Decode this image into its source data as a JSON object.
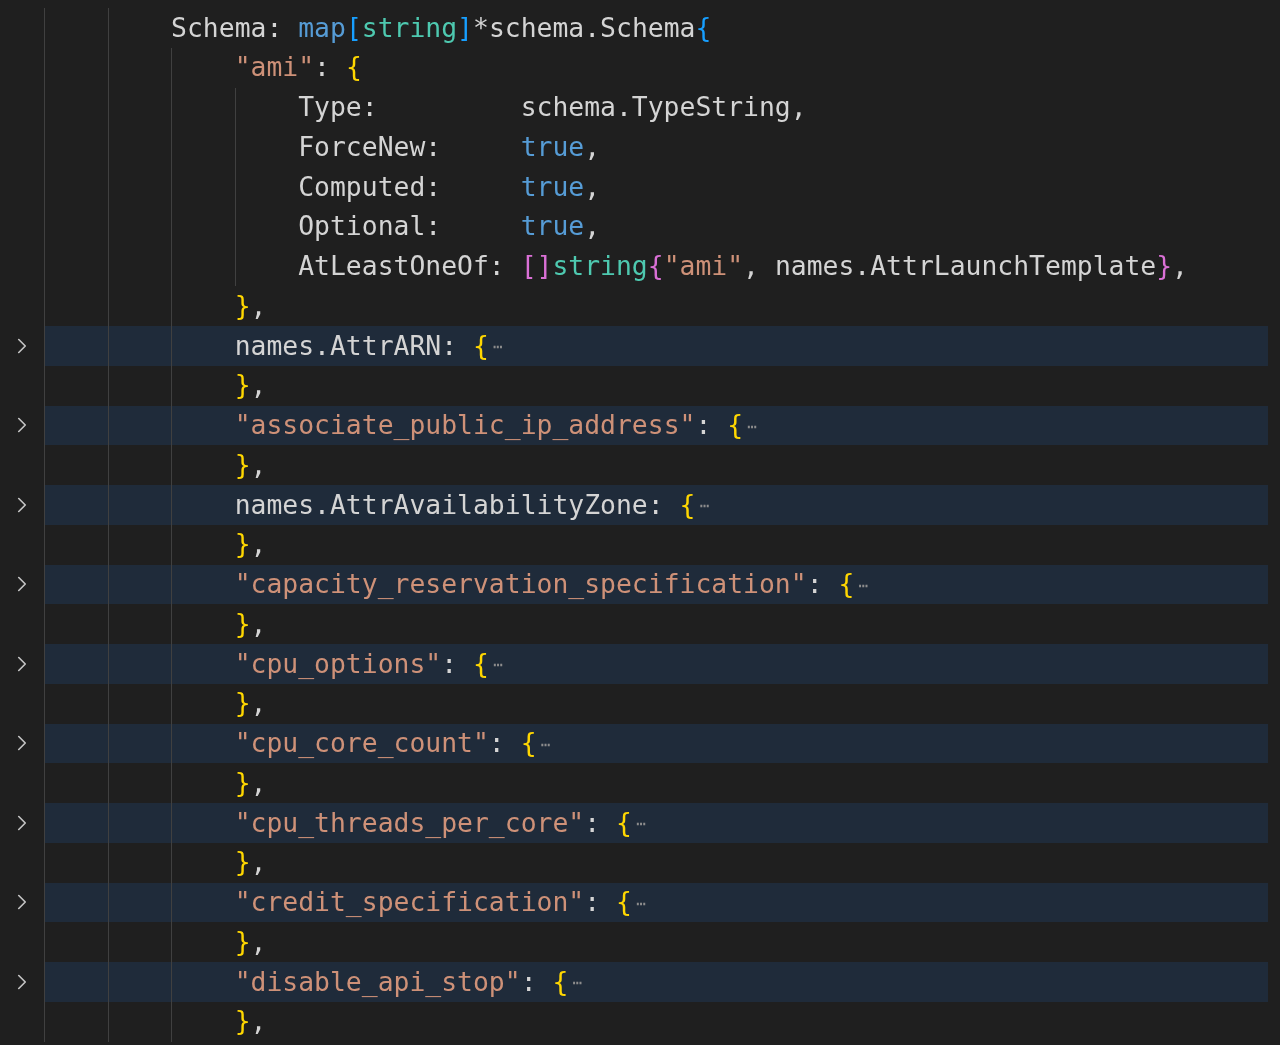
{
  "editor": {
    "lines": [
      {
        "folded": false,
        "tokens": [
          {
            "text": "Schema: ",
            "kind": "plain"
          },
          {
            "text": "map",
            "kind": "keyword"
          },
          {
            "text": "[",
            "kind": "bracket_blue"
          },
          {
            "text": "string",
            "kind": "type"
          },
          {
            "text": "]",
            "kind": "bracket_blue"
          },
          {
            "text": "*schema.Schema",
            "kind": "plain"
          },
          {
            "text": "{",
            "kind": "bracket_blue"
          }
        ],
        "children": [
          {
            "folded": false,
            "tokens": [
              {
                "text": "\"ami\"",
                "kind": "string"
              },
              {
                "text": ": ",
                "kind": "plain"
              },
              {
                "text": "{",
                "kind": "bracket_yellow"
              }
            ],
            "children": [
              {
                "folded": false,
                "tokens": [
                  {
                    "text": "Type:         schema.TypeString,",
                    "kind": "plain"
                  }
                ]
              },
              {
                "folded": false,
                "tokens": [
                  {
                    "text": "ForceNew:     ",
                    "kind": "plain"
                  },
                  {
                    "text": "true",
                    "kind": "keyword"
                  },
                  {
                    "text": ",",
                    "kind": "plain"
                  }
                ]
              },
              {
                "folded": false,
                "tokens": [
                  {
                    "text": "Computed:     ",
                    "kind": "plain"
                  },
                  {
                    "text": "true",
                    "kind": "keyword"
                  },
                  {
                    "text": ",",
                    "kind": "plain"
                  }
                ]
              },
              {
                "folded": false,
                "tokens": [
                  {
                    "text": "Optional:     ",
                    "kind": "plain"
                  },
                  {
                    "text": "true",
                    "kind": "keyword"
                  },
                  {
                    "text": ",",
                    "kind": "plain"
                  }
                ]
              },
              {
                "folded": false,
                "tokens": [
                  {
                    "text": "AtLeastOneOf: ",
                    "kind": "plain"
                  },
                  {
                    "text": "[]",
                    "kind": "bracket_pink"
                  },
                  {
                    "text": "string",
                    "kind": "type"
                  },
                  {
                    "text": "{",
                    "kind": "bracket_pink"
                  },
                  {
                    "text": "\"ami\"",
                    "kind": "string"
                  },
                  {
                    "text": ", names.AttrLaunchTemplate",
                    "kind": "plain"
                  },
                  {
                    "text": "}",
                    "kind": "bracket_pink"
                  },
                  {
                    "text": ",",
                    "kind": "plain"
                  }
                ]
              }
            ]
          },
          {
            "folded": false,
            "tokens": [
              {
                "text": "}",
                "kind": "bracket_yellow"
              },
              {
                "text": ",",
                "kind": "plain"
              }
            ]
          },
          {
            "folded": true,
            "tokens": [
              {
                "text": "names.AttrARN: ",
                "kind": "plain"
              },
              {
                "text": "{",
                "kind": "bracket_yellow"
              },
              {
                "text": "⋯",
                "kind": "fold"
              }
            ]
          },
          {
            "folded": false,
            "tokens": [
              {
                "text": "}",
                "kind": "bracket_yellow"
              },
              {
                "text": ",",
                "kind": "plain"
              }
            ]
          },
          {
            "folded": true,
            "tokens": [
              {
                "text": "\"associate_public_ip_address\"",
                "kind": "string"
              },
              {
                "text": ": ",
                "kind": "plain"
              },
              {
                "text": "{",
                "kind": "bracket_yellow"
              },
              {
                "text": "⋯",
                "kind": "fold"
              }
            ]
          },
          {
            "folded": false,
            "tokens": [
              {
                "text": "}",
                "kind": "bracket_yellow"
              },
              {
                "text": ",",
                "kind": "plain"
              }
            ]
          },
          {
            "folded": true,
            "tokens": [
              {
                "text": "names.AttrAvailabilityZone: ",
                "kind": "plain"
              },
              {
                "text": "{",
                "kind": "bracket_yellow"
              },
              {
                "text": "⋯",
                "kind": "fold"
              }
            ]
          },
          {
            "folded": false,
            "tokens": [
              {
                "text": "}",
                "kind": "bracket_yellow"
              },
              {
                "text": ",",
                "kind": "plain"
              }
            ]
          },
          {
            "folded": true,
            "tokens": [
              {
                "text": "\"capacity_reservation_specification\"",
                "kind": "string"
              },
              {
                "text": ": ",
                "kind": "plain"
              },
              {
                "text": "{",
                "kind": "bracket_yellow"
              },
              {
                "text": "⋯",
                "kind": "fold"
              }
            ]
          },
          {
            "folded": false,
            "tokens": [
              {
                "text": "}",
                "kind": "bracket_yellow"
              },
              {
                "text": ",",
                "kind": "plain"
              }
            ]
          },
          {
            "folded": true,
            "tokens": [
              {
                "text": "\"cpu_options\"",
                "kind": "string"
              },
              {
                "text": ": ",
                "kind": "plain"
              },
              {
                "text": "{",
                "kind": "bracket_yellow"
              },
              {
                "text": "⋯",
                "kind": "fold"
              }
            ]
          },
          {
            "folded": false,
            "tokens": [
              {
                "text": "}",
                "kind": "bracket_yellow"
              },
              {
                "text": ",",
                "kind": "plain"
              }
            ]
          },
          {
            "folded": true,
            "tokens": [
              {
                "text": "\"cpu_core_count\"",
                "kind": "string"
              },
              {
                "text": ": ",
                "kind": "plain"
              },
              {
                "text": "{",
                "kind": "bracket_yellow"
              },
              {
                "text": "⋯",
                "kind": "fold"
              }
            ]
          },
          {
            "folded": false,
            "tokens": [
              {
                "text": "}",
                "kind": "bracket_yellow"
              },
              {
                "text": ",",
                "kind": "plain"
              }
            ]
          },
          {
            "folded": true,
            "tokens": [
              {
                "text": "\"cpu_threads_per_core\"",
                "kind": "string"
              },
              {
                "text": ": ",
                "kind": "plain"
              },
              {
                "text": "{",
                "kind": "bracket_yellow"
              },
              {
                "text": "⋯",
                "kind": "fold"
              }
            ]
          },
          {
            "folded": false,
            "tokens": [
              {
                "text": "}",
                "kind": "bracket_yellow"
              },
              {
                "text": ",",
                "kind": "plain"
              }
            ]
          },
          {
            "folded": true,
            "tokens": [
              {
                "text": "\"credit_specification\"",
                "kind": "string"
              },
              {
                "text": ": ",
                "kind": "plain"
              },
              {
                "text": "{",
                "kind": "bracket_yellow"
              },
              {
                "text": "⋯",
                "kind": "fold"
              }
            ]
          },
          {
            "folded": false,
            "tokens": [
              {
                "text": "}",
                "kind": "bracket_yellow"
              },
              {
                "text": ",",
                "kind": "plain"
              }
            ]
          },
          {
            "folded": true,
            "tokens": [
              {
                "text": "\"disable_api_stop\"",
                "kind": "string"
              },
              {
                "text": ": ",
                "kind": "plain"
              },
              {
                "text": "{",
                "kind": "bracket_yellow"
              },
              {
                "text": "⋯",
                "kind": "fold"
              }
            ]
          },
          {
            "folded": false,
            "tokens": [
              {
                "text": "}",
                "kind": "bracket_yellow"
              },
              {
                "text": ",",
                "kind": "plain"
              }
            ]
          }
        ]
      }
    ]
  }
}
